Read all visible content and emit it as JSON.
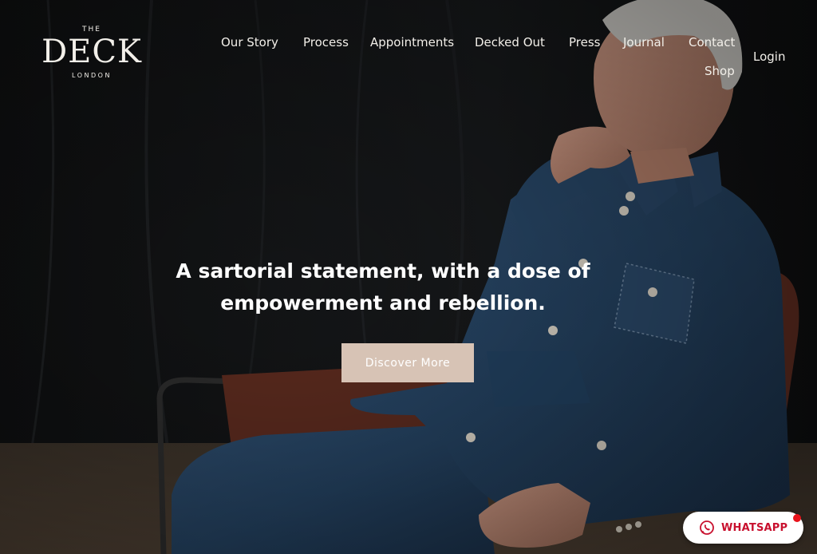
{
  "brand": {
    "top": "THE",
    "name": "DECK",
    "sub": "LONDON"
  },
  "nav": {
    "our_story": "Our Story",
    "process": "Process",
    "appointments": "Appointments",
    "decked_out": "Decked Out",
    "press": "Press",
    "journal": "Journal",
    "contact": "Contact",
    "shop": "Shop",
    "login": "Login"
  },
  "hero": {
    "headline_line1": "A sartorial statement, with a dose of",
    "headline_line2": "empowerment and rebellion.",
    "cta_label": "Discover More"
  },
  "whatsapp": {
    "label": "WHATSAPP",
    "icon": "whatsapp-icon"
  },
  "colors": {
    "background": "#121212",
    "cta": "#d7c3b5",
    "whatsapp_text": "#c8102e",
    "notification_dot": "#e8121a"
  }
}
